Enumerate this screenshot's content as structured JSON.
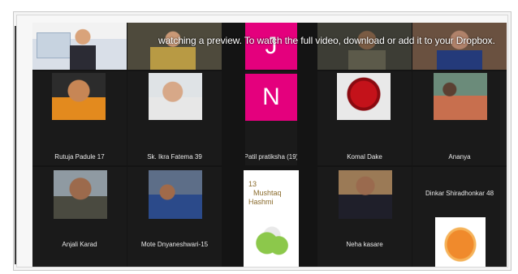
{
  "banner": {
    "text": "watching a preview. To watch the full video, download or add it to your Dropbox."
  },
  "colors": {
    "j_tile": "#e4007d",
    "n_tile": "#e4007d",
    "grid_bg": "#141414"
  },
  "tiles": [
    {
      "name": "Rutuja Padule 17"
    },
    {
      "name": "Sk. Ikra Fatema 39"
    },
    {
      "name": "Patil pratiksha (19)"
    },
    {
      "name": "Komal Dake"
    },
    {
      "name": "Ananya"
    },
    {
      "name": "Dinkar Shiradhonkar 48"
    },
    {
      "name": "Anjali Karad"
    },
    {
      "name": "Mote Dnyaneshwari-15"
    },
    {
      "name": "Neha kasare"
    }
  ],
  "letters": {
    "j": "J",
    "n": "N"
  },
  "card": {
    "line1": "13",
    "line2": "Mushtaq",
    "line3": "Hashmi"
  }
}
